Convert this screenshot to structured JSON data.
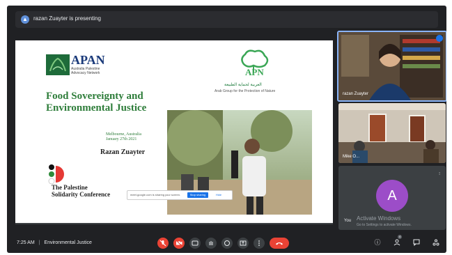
{
  "meeting": {
    "presenting_text": "razan Zuayter is presenting",
    "time": "7:25 AM",
    "separator": "|",
    "meeting_title": "Environmental Justice"
  },
  "slide": {
    "apan_name": "APAN",
    "apan_subtitle": "Australia Palestine Advocacy Network",
    "apn_name": "APN",
    "apn_arabic": "العربية لحماية الطبيعة",
    "apn_subtitle": "Arab Group for the Protection of Nature",
    "title": "Food Sovereignty and Environmental Justice",
    "location": "Melbourne, Australia",
    "date": "January 27th 2021",
    "presenter": "Razan Zuayter",
    "conference": "The Palestine Solidarity Conference"
  },
  "share_bar": {
    "message": "meet.google.com is sharing your screen.",
    "stop_label": "Stop sharing",
    "hide_label": "Hide"
  },
  "participants": [
    {
      "name": "razan Zuayter"
    },
    {
      "name": "Mike O..."
    },
    {
      "name": "You",
      "initial": "A"
    }
  ],
  "watermark": {
    "title": "Activate Windows",
    "subtitle": "Go to Settings to activate Windows."
  },
  "controls": {
    "mic": "mic-off-icon",
    "camera": "camera-off-icon",
    "captions": "captions-icon",
    "raise_hand": "hand-icon",
    "emoji": "emoji-icon",
    "present": "present-icon",
    "more": "more-icon",
    "leave": "phone-hangup-icon",
    "participants_count": "4"
  },
  "colors": {
    "background": "#202124",
    "leave_red": "#ea4335",
    "title_green": "#2e7d3a",
    "avatar_purple": "#9c4dc8",
    "active_border": "#8ab4f8"
  }
}
